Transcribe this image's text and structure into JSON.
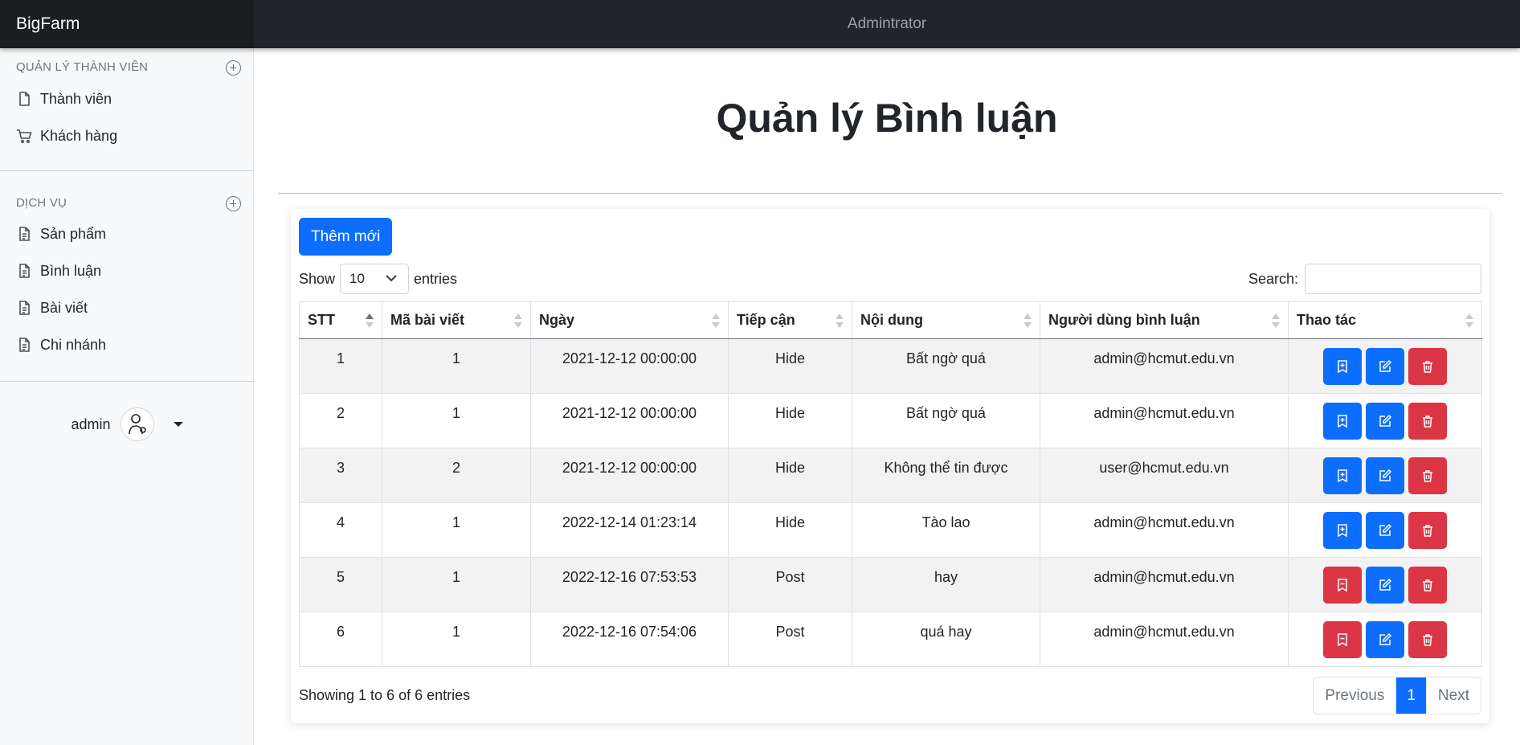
{
  "brand": "BigFarm",
  "topbar_title": "Admintrator",
  "sidebar": {
    "sections": [
      {
        "heading": "QUẢN LÝ THÀNH VIÊN",
        "items": [
          {
            "label": "Thành viên",
            "icon": "file-icon"
          },
          {
            "label": "Khách hàng",
            "icon": "cart-icon"
          }
        ]
      },
      {
        "heading": "DỊCH VỤ",
        "items": [
          {
            "label": "Sản phẩm",
            "icon": "file-text-icon"
          },
          {
            "label": "Bình luận",
            "icon": "file-text-icon"
          },
          {
            "label": "Bài viết",
            "icon": "file-text-icon"
          },
          {
            "label": "Chi nhánh",
            "icon": "file-text-icon"
          }
        ]
      }
    ],
    "user": "admin"
  },
  "page_title": "Quản lý Bình luận",
  "add_button": "Thêm mới",
  "length": {
    "show": "Show",
    "value": "10",
    "entries": "entries"
  },
  "search_label": "Search:",
  "table": {
    "columns": [
      "STT",
      "Mã bài viết",
      "Ngày",
      "Tiếp cận",
      "Nội dung",
      "Người dùng bình luận",
      "Thao tác"
    ],
    "rows": [
      [
        "1",
        "1",
        "2021-12-12 00:00:00",
        "Hide",
        "Bất ngờ quá",
        "admin@hcmut.edu.vn"
      ],
      [
        "2",
        "1",
        "2021-12-12 00:00:00",
        "Hide",
        "Bất ngờ quá",
        "admin@hcmut.edu.vn"
      ],
      [
        "3",
        "2",
        "2021-12-12 00:00:00",
        "Hide",
        "Không thể tin được",
        "user@hcmut.edu.vn"
      ],
      [
        "4",
        "1",
        "2022-12-14 01:23:14",
        "Hide",
        "Tào lao",
        "admin@hcmut.edu.vn"
      ],
      [
        "5",
        "1",
        "2022-12-16 07:53:53",
        "Post",
        "hay",
        "admin@hcmut.edu.vn"
      ],
      [
        "6",
        "1",
        "2022-12-16 07:54:06",
        "Post",
        "quá hay",
        "admin@hcmut.edu.vn"
      ]
    ]
  },
  "colors": {
    "primary": "#0d6efd",
    "danger": "#dc3545"
  },
  "info": "Showing 1 to 6 of 6 entries",
  "pager": {
    "previous": "Previous",
    "current": "1",
    "next": "Next"
  }
}
